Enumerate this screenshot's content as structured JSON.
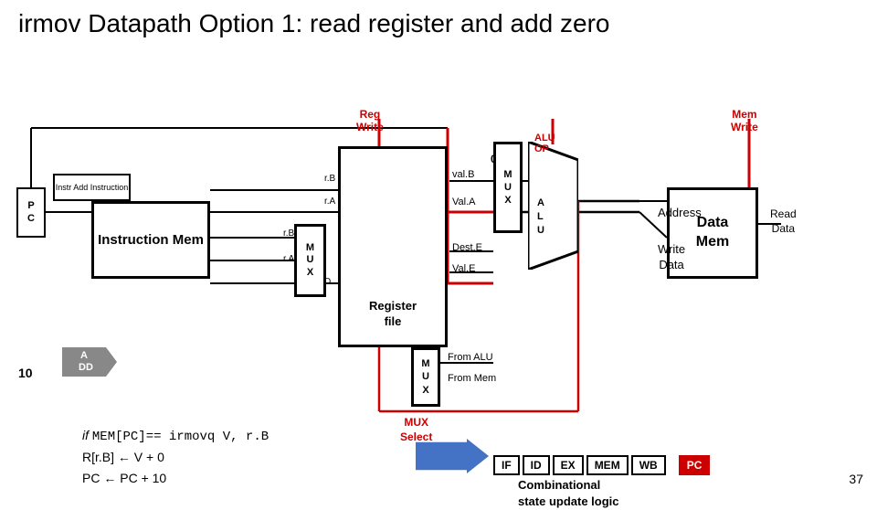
{
  "title": "irmov Datapath Option 1: read register and add zero",
  "pc_block": {
    "label": "P\nC"
  },
  "instr_add": {
    "label": "Instr\nAdd Instruction"
  },
  "instr_mem": {
    "label": "Instruction\nMem"
  },
  "add_dd": {
    "label": "A\nDD"
  },
  "ten_label": "10",
  "reg_write": {
    "line1": "Reg",
    "line2": "Write"
  },
  "mem_write": {
    "line1": "Mem",
    "line2": "Write"
  },
  "mux_main": {
    "label": "M\nU\nX"
  },
  "mux2": {
    "label": "M\nU\nX"
  },
  "mux3": {
    "label": "M\nU\nX"
  },
  "alu_op": "ALU\nOP",
  "zero": "0",
  "port_rB": "r.B",
  "port_rA": "r.A",
  "port_rBm": "r.B",
  "port_rAm": "r.A",
  "port_D": "D",
  "val_B": "val.B",
  "val_A": "Val.A",
  "dest_E": "Dest.E",
  "val_E": "Val.E",
  "reg_file": {
    "label": "Register",
    "sublabel": "file"
  },
  "address_label": "Address",
  "write_data": {
    "line1": "Write",
    "line2": "Data"
  },
  "read_data": {
    "line1": "Read",
    "line2": "Data"
  },
  "data_mem": {
    "label": "Data\nMem"
  },
  "from_alu": "From ALU",
  "from_mem": "From Mem",
  "mux_select": {
    "line1": "MUX",
    "line2": "Select"
  },
  "code": {
    "line1_if": "if",
    "line1_code": "MEM[PC]==",
    "line1_instr": "irmovq",
    "line1_rest": "V, r.B",
    "line2": "R[r.B] ← V + 0",
    "line3": "PC ← PC + 10"
  },
  "pipeline": {
    "if": "IF",
    "id": "ID",
    "ex": "EX",
    "mem": "MEM",
    "wb": "WB",
    "pc": "PC"
  },
  "comb": {
    "line1": "Combinational",
    "line2": "state update logic"
  },
  "slide_number": "37"
}
